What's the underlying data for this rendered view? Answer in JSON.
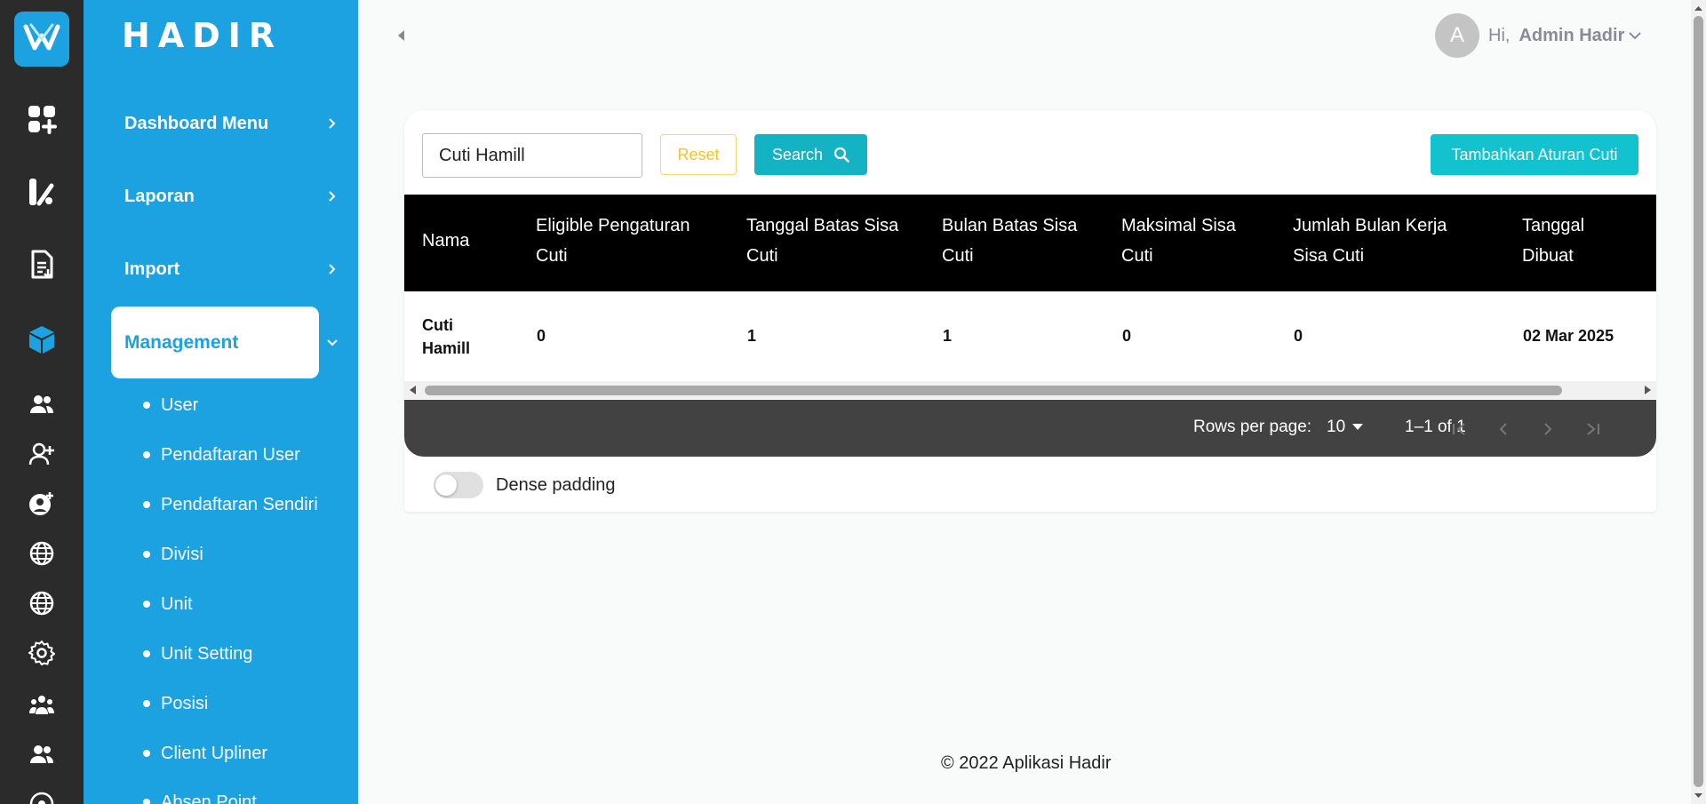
{
  "brand": "HADIR",
  "sidebar": {
    "nav": [
      {
        "label": "Dashboard Menu"
      },
      {
        "label": "Laporan"
      },
      {
        "label": "Import"
      }
    ],
    "active": "Management",
    "sub_items": [
      {
        "label": "User"
      },
      {
        "label": "Pendaftaran User"
      },
      {
        "label": "Pendaftaran Sendiri"
      },
      {
        "label": "Divisi"
      },
      {
        "label": "Unit"
      },
      {
        "label": "Unit Setting"
      },
      {
        "label": "Posisi"
      },
      {
        "label": "Client Upliner"
      },
      {
        "label": "Absen Point"
      }
    ]
  },
  "header": {
    "avatar_letter": "A",
    "greeting": "Hi,",
    "user_name": "Admin Hadir"
  },
  "toolbar": {
    "search_value": "Cuti Hamill",
    "reset_label": "Reset",
    "search_label": "Search",
    "add_label": "Tambahkan Aturan Cuti"
  },
  "table": {
    "columns": [
      "Nama",
      "Eligible Pengaturan Cuti",
      "Tanggal Batas Sisa Cuti",
      "Bulan Batas Sisa Cuti",
      "Maksimal Sisa Cuti",
      "Jumlah Bulan Kerja Sisa Cuti",
      "Tanggal Dibuat"
    ],
    "rows": [
      [
        "Cuti Hamill",
        "0",
        "1",
        "1",
        "0",
        "0",
        "02 Mar 2025"
      ]
    ]
  },
  "pagination": {
    "rows_per_page_label": "Rows per page:",
    "rows_per_page": "10",
    "range": "1–1 of 1"
  },
  "dense_padding_label": "Dense padding",
  "footer": "© 2022 Aplikasi Hadir",
  "colors": {
    "rail": "#2b2b2b",
    "sidebar": "#1ca1e1",
    "teal": "#14b3c3",
    "reset": "#f7c131",
    "table_header": "#000000",
    "table_footer": "#424242"
  }
}
